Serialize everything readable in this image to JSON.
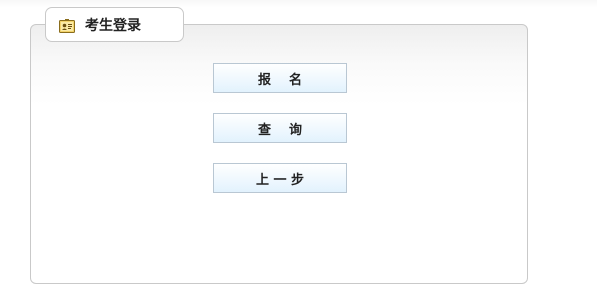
{
  "panel": {
    "title": "考生登录",
    "icon": "id-card-icon"
  },
  "buttons": {
    "signup_label": "报    名",
    "query_label": "查    询",
    "back_label": "上 一 步"
  },
  "colors": {
    "button_border": "#b9c7d3",
    "button_gradient_bottom": "#e2f2fd",
    "panel_border": "#c9c9c9"
  }
}
